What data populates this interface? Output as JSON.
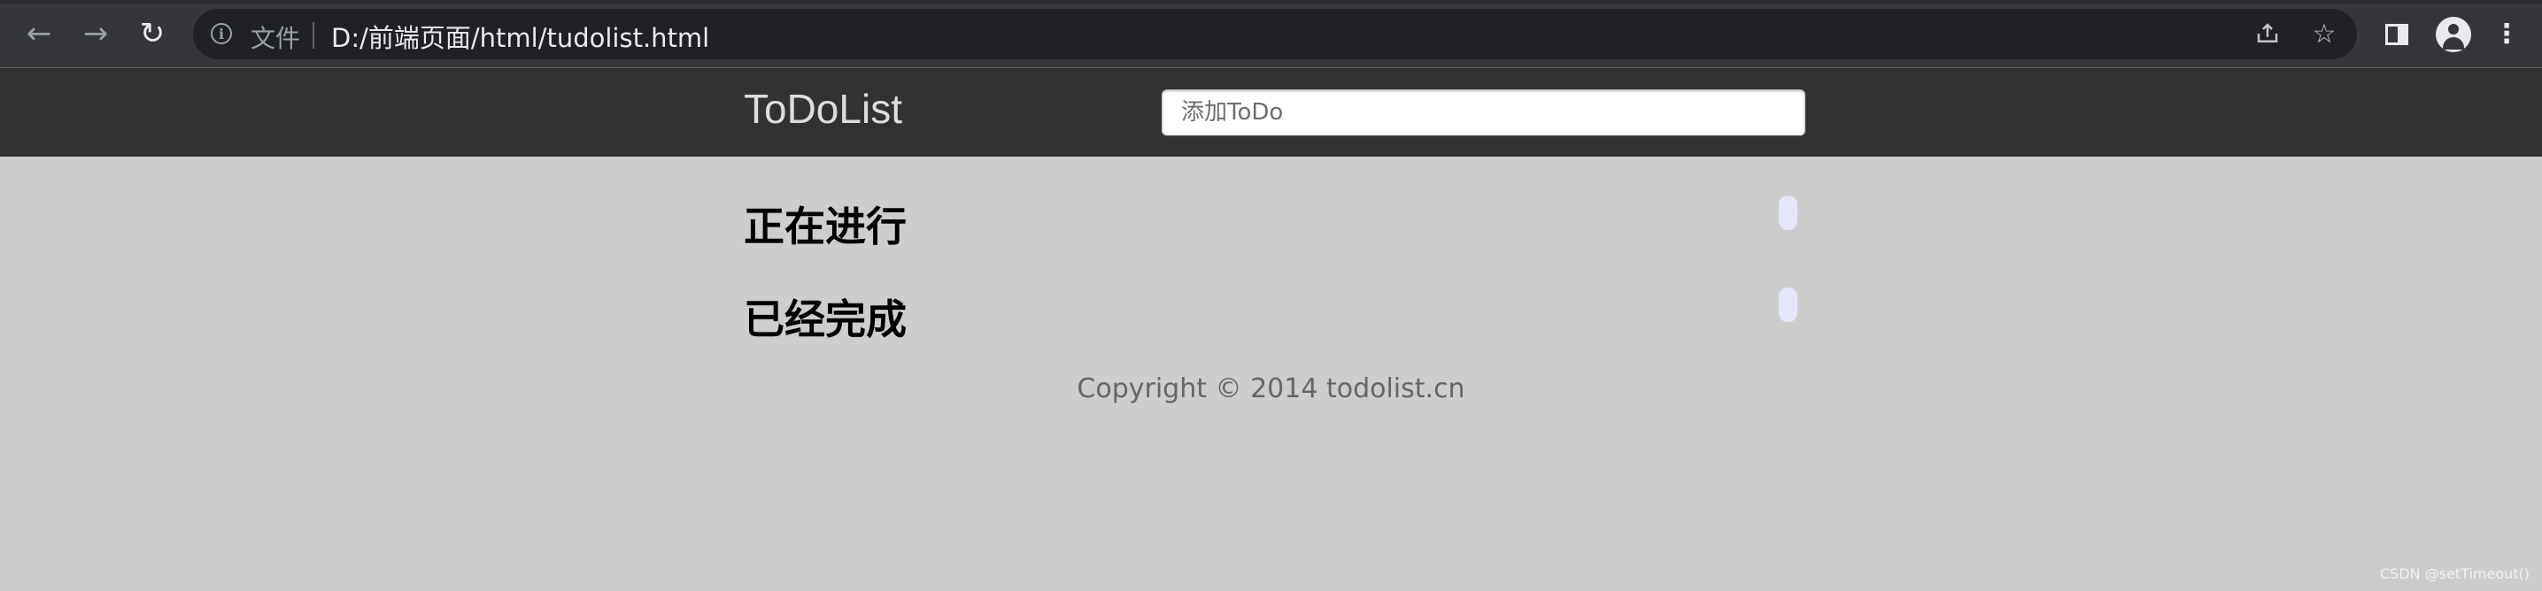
{
  "browser": {
    "scheme_label": "文件",
    "url": "D:/前端页面/html/tudolist.html",
    "icons": {
      "back": "arrow-left-icon",
      "forward": "arrow-right-icon",
      "reload": "reload-icon",
      "site_info": "info-icon",
      "share": "share-icon",
      "bookmark": "star-icon",
      "side_panel": "side-panel-icon",
      "profile": "avatar-icon",
      "menu": "kebab-menu-icon"
    }
  },
  "header": {
    "brand": "ToDoList",
    "input_placeholder": "添加ToDo",
    "input_value": ""
  },
  "sections": [
    {
      "title": "正在进行",
      "count": ""
    },
    {
      "title": "已经完成",
      "count": ""
    }
  ],
  "footer": {
    "copyright": "Copyright © 2014 todolist.cn"
  },
  "watermark": "CSDN @setTimeout()",
  "colors": {
    "header_bg": "#323232",
    "page_bg": "#cdcdcd",
    "badge_bg": "#e6e6fa",
    "chrome_bg": "#35363a",
    "omnibox_bg": "#202124"
  }
}
